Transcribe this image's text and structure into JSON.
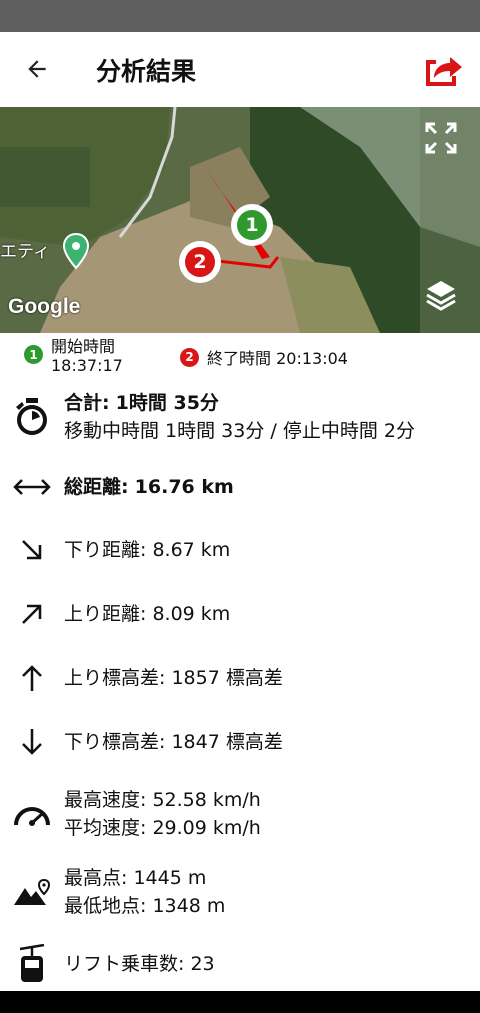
{
  "app_bar": {
    "title": "分析結果",
    "back_icon": "arrow-left-icon",
    "share_icon": "share-icon",
    "accent": "#d81616"
  },
  "map": {
    "attribution": "Google",
    "place_label": "エティ",
    "start_marker": "1",
    "end_marker": "2",
    "expand_icon": "fullscreen-icon",
    "layers_icon": "layers-icon"
  },
  "times": {
    "start_badge": "1",
    "start_label": "開始時間",
    "start_value": "18:37:17",
    "end_badge": "2",
    "end_label": "終了時間 20:13:04"
  },
  "stats": {
    "total_label": "合計:",
    "total_value": "1時間 35分",
    "moving": "移動中時間 1時間 33分 / 停止中時間 2分",
    "distance_label": "総距離:",
    "distance_value": "16.76 km",
    "down_distance": "下り距離: 8.67 km",
    "up_distance": "上り距離: 8.09 km",
    "ascent": "上り標高差: 1857 標高差",
    "descent": "下り標高差: 1847 標高差",
    "max_speed": "最高速度: 52.58 km/h",
    "avg_speed": "平均速度: 29.09 km/h",
    "max_alt": "最高点: 1445 m",
    "min_alt": "最低地点: 1348 m",
    "lifts": "リフト乗車数: 23"
  }
}
